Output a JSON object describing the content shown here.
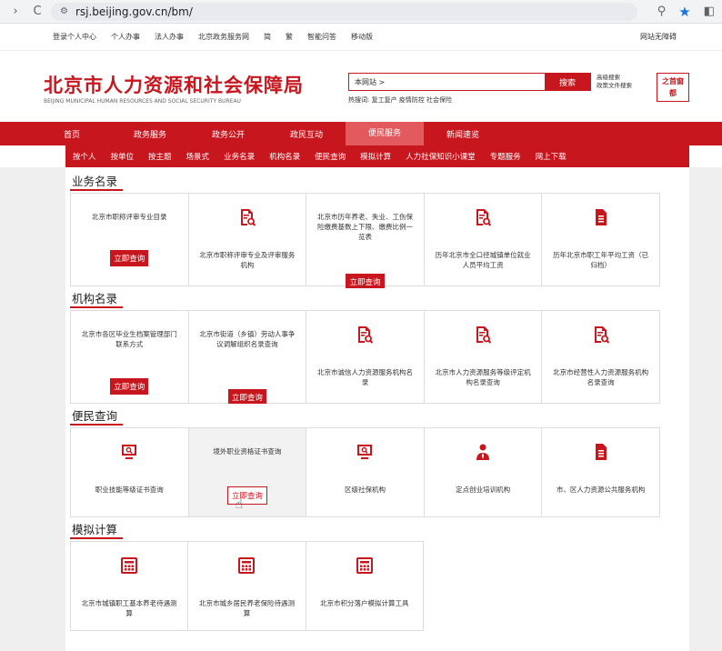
{
  "browser": {
    "url": "rsj.beijing.gov.cn/bm/"
  },
  "top_links": {
    "items": [
      "登录个人中心",
      "个人办事",
      "法人办事",
      "北京政务服务网",
      "简",
      "繁",
      "智能问答",
      "移动版"
    ],
    "right": "网站无障碍"
  },
  "header": {
    "title": "北京市人力资源和社会保障局",
    "subtitle": "BEIJING MUNICIPAL HUMAN RESOURCES AND SOCIAL SECURITY BUREAU",
    "search_value": "本网站 >",
    "search_button": "搜索",
    "hot_words": "热搜词:  复工复产  疫情防控  社会保险",
    "advanced_search": "高级搜索",
    "policy_search": "政策文件搜索",
    "seal_text": [
      "之",
      "首",
      "窗",
      "都"
    ]
  },
  "main_nav": [
    "首页",
    "政务服务",
    "政务公开",
    "政民互动",
    "便民服务",
    "新闻速览"
  ],
  "main_nav_active": "便民服务",
  "sub_nav": [
    "按个人",
    "按单位",
    "按主题",
    "场景式",
    "业务名录",
    "机构名录",
    "便民查询",
    "模拟计算",
    "人力社保知识小课堂",
    "专题服务",
    "网上下载"
  ],
  "sections": {
    "business": {
      "title": "业务名录",
      "cells": [
        {
          "text": "北京市职称评审专业目录",
          "button": "立即查询"
        },
        {
          "text": "北京市职称评审专业及评审服务机构",
          "icon": "document-search-icon"
        },
        {
          "text": "北京市历年养老、失业、工伤保险缴费基数上下限、缴费比例一览表",
          "button": "立即查询"
        },
        {
          "text": "历年北京市全口径城镇单位就业人员平均工资",
          "icon": "document-search-icon"
        },
        {
          "text": "历年北京市职工年平均工资（已归档）",
          "icon": "document-icon"
        }
      ]
    },
    "institutions": {
      "title": "机构名录",
      "cells": [
        {
          "text": "北京市各区毕业生档案管理部门联系方式",
          "button": "立即查询"
        },
        {
          "text": "北京市街道（乡镇）劳动人事争议调解组织名录查询",
          "button": "立即查询"
        },
        {
          "text": "北京市诚信人力资源服务机构名录",
          "icon": "document-search-icon"
        },
        {
          "text": "北京市人力资源服务等级评定机构名录查询",
          "icon": "document-search-icon"
        },
        {
          "text": "北京市经营性人力资源服务机构名录查询",
          "icon": "document-search-icon"
        }
      ]
    },
    "convenience": {
      "title": "便民查询",
      "cells": [
        {
          "text": "职业技能等级证书查询",
          "icon": "monitor-search-icon"
        },
        {
          "text": "境外职业资格证书查询",
          "button": "立即查询"
        },
        {
          "text": "区级社保机构",
          "icon": "monitor-search-icon"
        },
        {
          "text": "定点创业培训机构",
          "icon": "person-icon"
        },
        {
          "text": "市、区人力资源公共服务机构",
          "icon": "document-icon"
        }
      ]
    },
    "simulation": {
      "title": "模拟计算",
      "cells": [
        {
          "text": "北京市城镇职工基本养老待遇测算",
          "icon": "calculator-icon"
        },
        {
          "text": "北京市城乡居民养老保险待遇测算",
          "icon": "calculator-icon"
        },
        {
          "text": "北京市积分落户模拟计算工具",
          "icon": "calculator-icon"
        }
      ]
    }
  },
  "colors": {
    "brand_red": "#c8161e",
    "nav_active": "#e25a5e",
    "hover_gray": "#f2f2f2"
  }
}
